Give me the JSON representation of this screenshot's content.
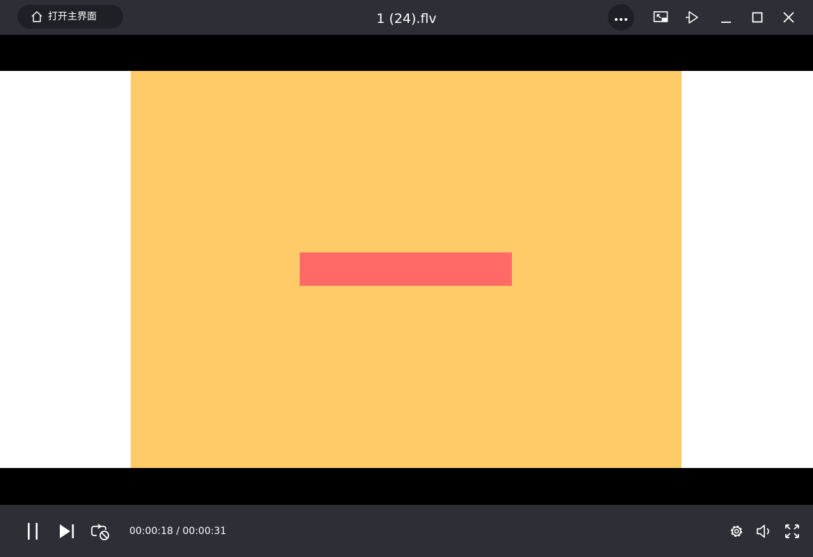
{
  "titlebar": {
    "home_label": "打开主界面",
    "title": "1 (24).flv",
    "icons": {
      "home": "home-icon",
      "more": "more-icon",
      "pip": "picture-in-picture-icon",
      "pin": "pin-on-top-icon",
      "minimize": "minimize-icon",
      "maximize": "maximize-icon",
      "close": "close-icon"
    }
  },
  "controls": {
    "current_time": "00:00:18",
    "separator": " / ",
    "total_time": "00:00:31",
    "icons": {
      "pause": "pause-icon",
      "next": "next-icon",
      "loop": "loop-off-icon",
      "settings": "gear-icon",
      "volume": "volume-icon",
      "fullscreen": "fullscreen-icon"
    }
  },
  "colors": {
    "chrome_bg": "#2d2e36",
    "button_bg": "#1f2026",
    "video_bg": "#fecb68",
    "video_bar": "#ff6966",
    "letterbox": "#000000",
    "pillarbox": "#ffffff"
  }
}
